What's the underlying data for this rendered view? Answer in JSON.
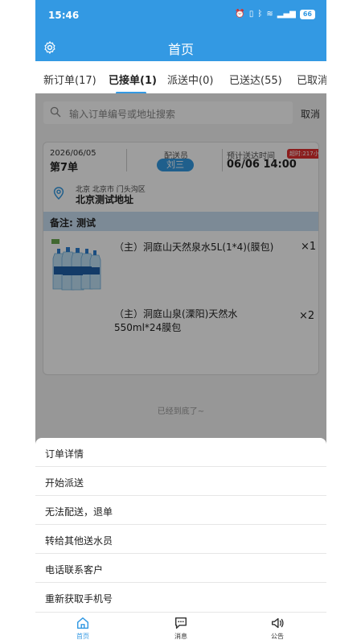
{
  "status_bar": {
    "time": "15:46",
    "battery": "66"
  },
  "header": {
    "title": "首页"
  },
  "tabs": [
    {
      "label": "新订单(17)"
    },
    {
      "label": "已接单(1)"
    },
    {
      "label": "派送中(0)"
    },
    {
      "label": "已送达(55)"
    },
    {
      "label": "已取消"
    }
  ],
  "search": {
    "placeholder": "输入订单编号或地址搜索",
    "cancel_label": "取消"
  },
  "order": {
    "date": "2026/06/05",
    "number": "第7单",
    "courier_label": "配送员",
    "courier_name": "刘三",
    "eta_label": "预计送达时间",
    "overdue_badge": "超时:217小时",
    "eta": "06/06 14:00",
    "region": "北京 北京市 门头沟区",
    "address": "北京测试地址",
    "remark": "备注: 测试",
    "items": [
      {
        "name": "（主）洞庭山天然泉水5L(1*4)(膜包)",
        "qty": "×1"
      },
      {
        "name_line1": "（主）洞庭山泉(溧阳)天然水",
        "name_line2": "550ml*24膜包",
        "qty": "×2"
      }
    ]
  },
  "list_end_text": "已经到底了~",
  "action_sheet": [
    {
      "label": "订单详情"
    },
    {
      "label": "开始派送"
    },
    {
      "label": "无法配送，退单"
    },
    {
      "label": "转给其他送水员"
    },
    {
      "label": "电话联系客户"
    },
    {
      "label": "重新获取手机号"
    }
  ],
  "bottom_nav": [
    {
      "label": "首页",
      "icon": "home-icon"
    },
    {
      "label": "消息",
      "icon": "message-icon"
    },
    {
      "label": "公告",
      "icon": "speaker-icon"
    }
  ],
  "colors": {
    "primary": "#3399e3",
    "overdue": "#e03030",
    "remark_bg": "#c9dff2"
  }
}
